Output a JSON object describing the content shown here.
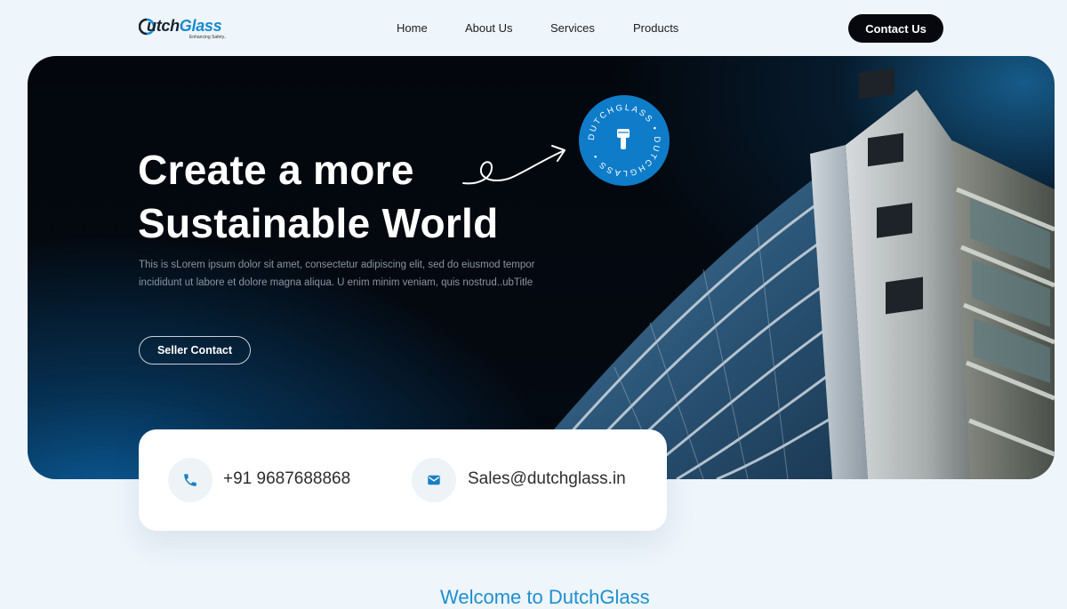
{
  "header": {
    "logo": {
      "word_dark": "utch",
      "word_accent": "Glass",
      "tagline": "Enhancing Safety.."
    },
    "nav": [
      {
        "label": "Home"
      },
      {
        "label": "About Us"
      },
      {
        "label": "Services"
      },
      {
        "label": "Products"
      }
    ],
    "cta_label": "Contact Us"
  },
  "hero": {
    "title_line1": "Create a more",
    "title_line2": "Sustainable World",
    "description": "This is sLorem ipsum dolor sit amet, consectetur adipiscing elit, sed do eiusmod tempor incididunt ut labore et dolore magna aliqua. U enim minim veniam, quis nostrud..ubTitle",
    "button_label": "Seller Contact",
    "badge_text": "DUTCHGLASS • DUTCHGLASS •"
  },
  "contact": {
    "phone": "+91 9687688868",
    "email": "Sales@dutchglass.in"
  },
  "welcome_text": "Welcome to DutchGlass",
  "colors": {
    "accent": "#1a8ad0",
    "badge": "#0e7cc9",
    "dark": "#06080d",
    "page_bg": "#eef5fb"
  },
  "icons": [
    "phone-icon",
    "mail-icon",
    "hand-icon",
    "arrow-squiggle-icon"
  ]
}
